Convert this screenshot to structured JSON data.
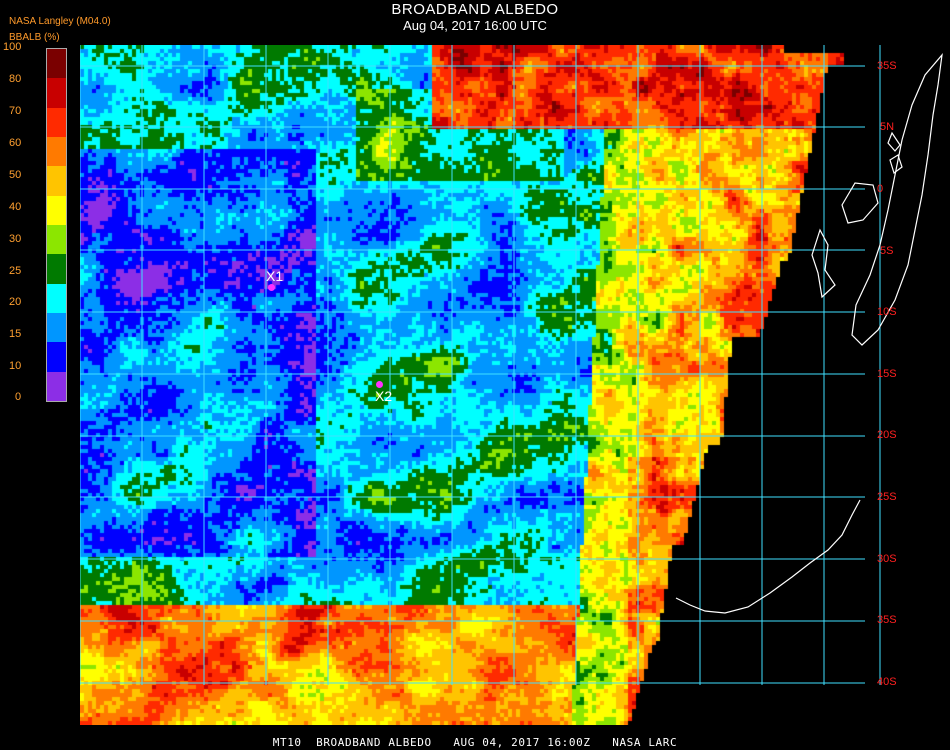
{
  "header": {
    "title": "BROADBAND ALBEDO",
    "datetime": "Aug 04, 2017 16:00 UTC",
    "producer": "NASA Langley (M04.0)"
  },
  "colorbar": {
    "label": "BBALB (%)",
    "ticks": [
      "100",
      "80",
      "70",
      "60",
      "50",
      "40",
      "30",
      "25",
      "20",
      "15",
      "10",
      "0"
    ],
    "colors": [
      "#7a0000",
      "#c80000",
      "#ff2a00",
      "#ff7a00",
      "#ffc400",
      "#ffff00",
      "#8ce600",
      "#007a00",
      "#00ffff",
      "#0096ff",
      "#0000ff",
      "#8c2ee6"
    ]
  },
  "map": {
    "lat_labels": [
      "35S",
      "5N",
      "0",
      "5S",
      "10S",
      "15S",
      "20S",
      "25S",
      "30S",
      "35S",
      "40S"
    ],
    "markers": [
      {
        "label": "X1"
      },
      {
        "label": "X2"
      }
    ],
    "gridline_color": "#40e0ff",
    "coastline_color": "#ffffff"
  },
  "footer": {
    "text": "MT10  BROADBAND ALBEDO   AUG 04, 2017 16:00Z   NASA LARC"
  }
}
